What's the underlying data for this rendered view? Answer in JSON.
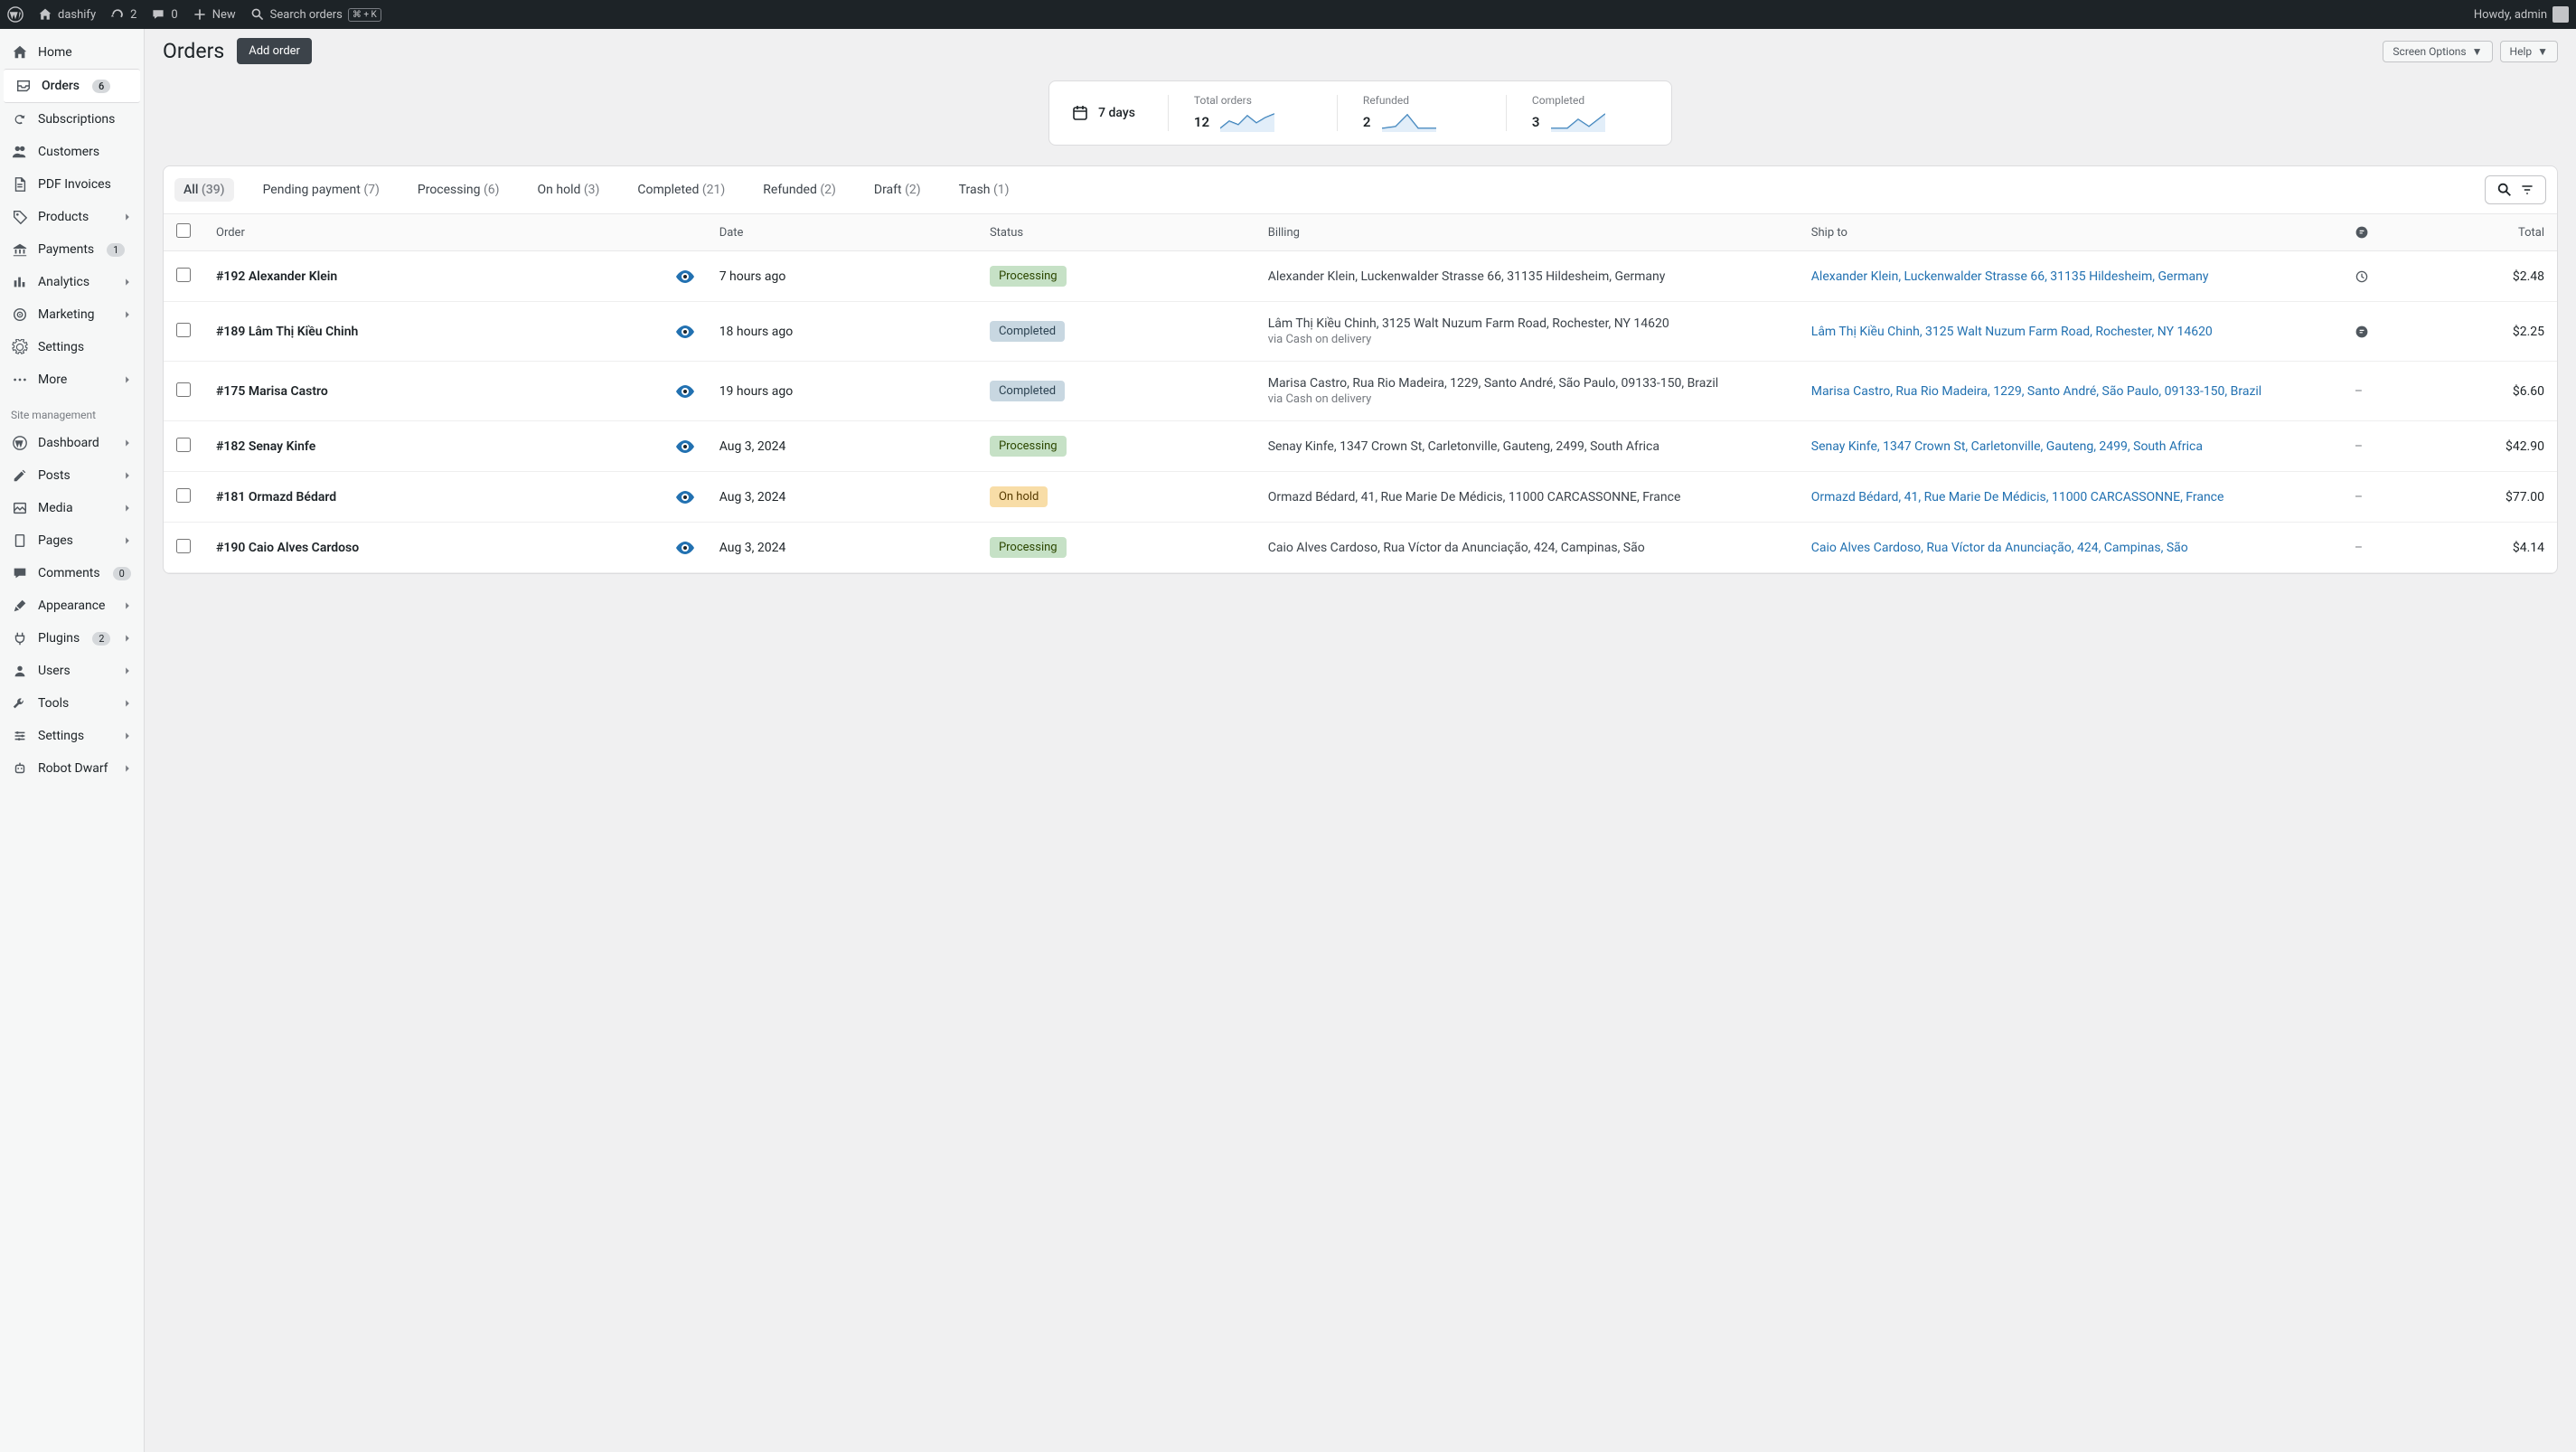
{
  "topbar": {
    "site": "dashify",
    "updates": "2",
    "comments": "0",
    "new": "New",
    "search": "Search orders",
    "shortcut": "⌘ + K",
    "howdy": "Howdy, admin"
  },
  "sidebar": {
    "items": [
      {
        "label": "Home",
        "icon": "home"
      },
      {
        "label": "Orders",
        "icon": "inbox",
        "badge": "6",
        "active": true
      },
      {
        "label": "Subscriptions",
        "icon": "refresh"
      },
      {
        "label": "Customers",
        "icon": "users"
      },
      {
        "label": "PDF Invoices",
        "icon": "file"
      },
      {
        "label": "Products",
        "icon": "tag",
        "chevron": true
      },
      {
        "label": "Payments",
        "icon": "bank",
        "badge": "1"
      },
      {
        "label": "Analytics",
        "icon": "bars",
        "chevron": true
      },
      {
        "label": "Marketing",
        "icon": "target",
        "chevron": true
      },
      {
        "label": "Settings",
        "icon": "gear"
      },
      {
        "label": "More",
        "icon": "dots",
        "chevron": true
      }
    ],
    "section_label": "Site management",
    "mgmt": [
      {
        "label": "Dashboard",
        "icon": "wp",
        "chevron": true
      },
      {
        "label": "Posts",
        "icon": "pencil",
        "chevron": true
      },
      {
        "label": "Media",
        "icon": "media",
        "chevron": true
      },
      {
        "label": "Pages",
        "icon": "page",
        "chevron": true
      },
      {
        "label": "Comments",
        "icon": "comment",
        "badge": "0"
      },
      {
        "label": "Appearance",
        "icon": "brush",
        "chevron": true
      },
      {
        "label": "Plugins",
        "icon": "plug",
        "badge": "2",
        "chevron": true
      },
      {
        "label": "Users",
        "icon": "user",
        "chevron": true
      },
      {
        "label": "Tools",
        "icon": "wrench",
        "chevron": true
      },
      {
        "label": "Settings",
        "icon": "sliders",
        "chevron": true
      },
      {
        "label": "Robot Dwarf",
        "icon": "robot",
        "chevron": true
      }
    ]
  },
  "header": {
    "title": "Orders",
    "add_order": "Add order",
    "screen_options": "Screen Options",
    "help": "Help"
  },
  "stats": {
    "period": "7 days",
    "metrics": [
      {
        "label": "Total orders",
        "value": "12"
      },
      {
        "label": "Refunded",
        "value": "2"
      },
      {
        "label": "Completed",
        "value": "3"
      }
    ]
  },
  "tabs": [
    {
      "label": "All",
      "count": "(39)",
      "active": true
    },
    {
      "label": "Pending payment",
      "count": "(7)"
    },
    {
      "label": "Processing",
      "count": "(6)"
    },
    {
      "label": "On hold",
      "count": "(3)"
    },
    {
      "label": "Completed",
      "count": "(21)"
    },
    {
      "label": "Refunded",
      "count": "(2)"
    },
    {
      "label": "Draft",
      "count": "(2)"
    },
    {
      "label": "Trash",
      "count": "(1)"
    }
  ],
  "table": {
    "headers": {
      "order": "Order",
      "date": "Date",
      "status": "Status",
      "billing": "Billing",
      "shipto": "Ship to",
      "total": "Total"
    },
    "rows": [
      {
        "order": "#192 Alexander Klein",
        "date": "7 hours ago",
        "status": "Processing",
        "status_class": "processing",
        "billing": "Alexander Klein, Luckenwalder Strasse 66, 31135 Hildesheim, Germany",
        "shipto": "Alexander Klein, Luckenwalder Strasse 66, 31135 Hildesheim, Germany",
        "note": "history",
        "total": "$2.48"
      },
      {
        "order": "#189 Lâm Thị Kiều Chinh",
        "date": "18 hours ago",
        "status": "Completed",
        "status_class": "completed",
        "billing": "Lâm Thị Kiều Chinh, 3125 Walt Nuzum Farm Road, Rochester, NY 14620",
        "via": "via Cash on delivery",
        "shipto": "Lâm Thị Kiều Chinh, 3125 Walt Nuzum Farm Road, Rochester, NY 14620",
        "note": "note",
        "total": "$2.25"
      },
      {
        "order": "#175 Marisa Castro",
        "date": "19 hours ago",
        "status": "Completed",
        "status_class": "completed",
        "billing": "Marisa Castro, Rua Rio Madeira, 1229, Santo André, São Paulo, 09133-150, Brazil",
        "via": "via Cash on delivery",
        "shipto": "Marisa Castro, Rua Rio Madeira, 1229, Santo André, São Paulo, 09133-150, Brazil",
        "note": "dash",
        "total": "$6.60"
      },
      {
        "order": "#182 Senay Kinfe",
        "date": "Aug 3, 2024",
        "status": "Processing",
        "status_class": "processing",
        "billing": "Senay Kinfe, 1347 Crown St, Carletonville, Gauteng, 2499, South Africa",
        "shipto": "Senay Kinfe, 1347 Crown St, Carletonville, Gauteng, 2499, South Africa",
        "note": "dash",
        "total": "$42.90"
      },
      {
        "order": "#181 Ormazd Bédard",
        "date": "Aug 3, 2024",
        "status": "On hold",
        "status_class": "on-hold",
        "billing": "Ormazd Bédard, 41, Rue Marie De Médicis, 11000 CARCASSONNE, France",
        "shipto": "Ormazd Bédard, 41, Rue Marie De Médicis, 11000 CARCASSONNE, France",
        "note": "dash",
        "total": "$77.00"
      },
      {
        "order": "#190 Caio Alves Cardoso",
        "date": "Aug 3, 2024",
        "status": "Processing",
        "status_class": "processing",
        "billing": "Caio Alves Cardoso, Rua Víctor da Anunciação, 424, Campinas, São",
        "shipto": "Caio Alves Cardoso, Rua Víctor da Anunciação, 424, Campinas, São",
        "note": "dash",
        "total": "$4.14"
      }
    ]
  }
}
